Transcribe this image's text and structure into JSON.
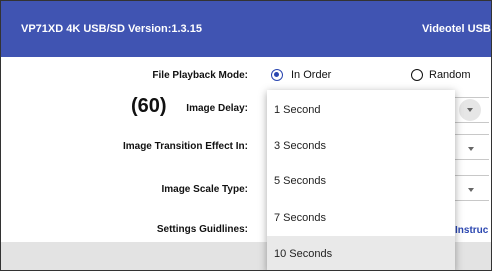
{
  "header": {
    "title": "VP71XD 4K USB/SD Version:1.3.15",
    "brand": "Videotel USB"
  },
  "form": {
    "playback_mode_label": "File Playback Mode:",
    "playback_options": [
      "In Order",
      "Random"
    ],
    "playback_selected": "In Order",
    "image_delay_count": "(60)",
    "image_delay_label": "Image Delay:",
    "transition_label": "Image Transition Effect In:",
    "scale_label": "Image Scale Type:",
    "guidelines_label": "Settings Guidlines:",
    "guidelines_link": "Instruc"
  },
  "dropdown": {
    "options": [
      "1 Second",
      "3 Seconds",
      "5 Seconds",
      "7 Seconds",
      "10 Seconds"
    ],
    "highlighted": "10 Seconds"
  },
  "colors": {
    "header_bg": "#4054b2",
    "accent": "#2a46b0"
  },
  "icons": {
    "radio": "radio-button-icon",
    "caret": "chevron-down-icon"
  }
}
